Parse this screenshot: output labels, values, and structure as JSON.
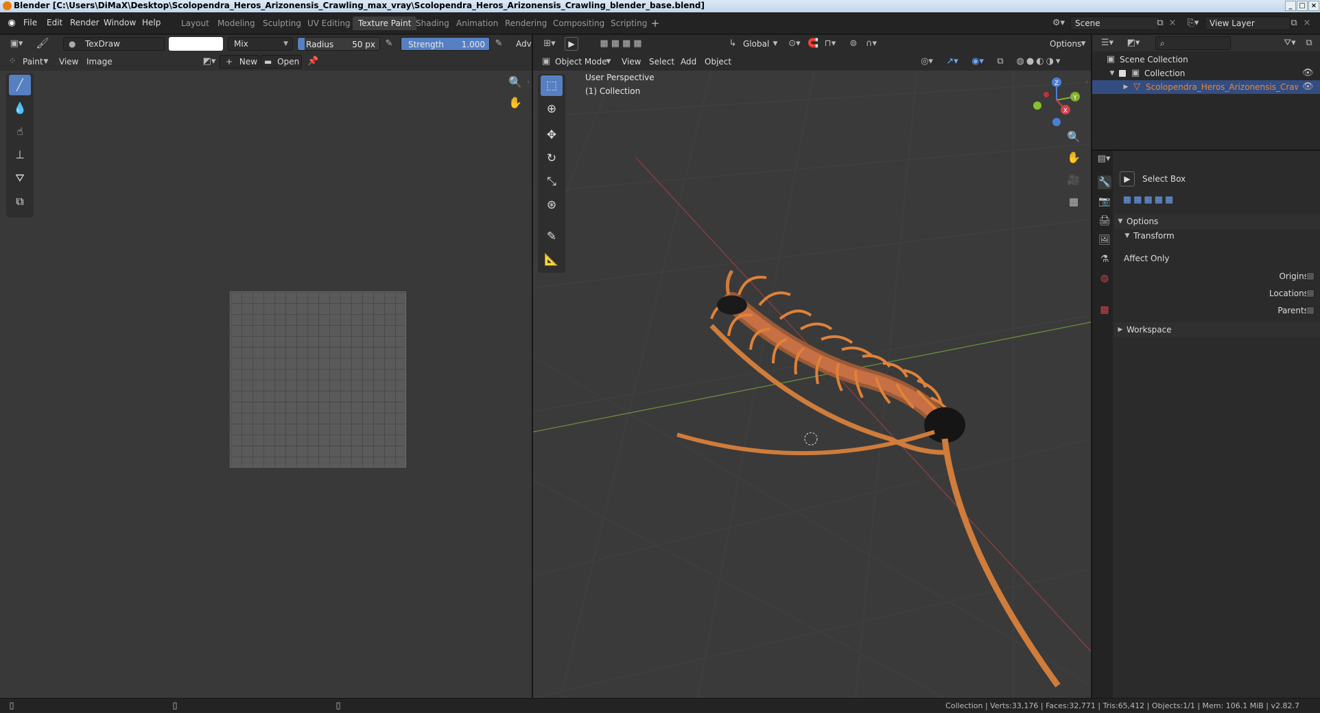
{
  "window": {
    "title": "Blender [C:\\Users\\DiMaX\\Desktop\\Scolopendra_Heros_Arizonensis_Crawling_max_vray\\Scolopendra_Heros_Arizonensis_Crawling_blender_base.blend]"
  },
  "menu": [
    "File",
    "Edit",
    "Render",
    "Window",
    "Help"
  ],
  "workspaces": [
    "Layout",
    "Modeling",
    "Sculpting",
    "UV Editing",
    "Texture Paint",
    "Shading",
    "Animation",
    "Rendering",
    "Compositing",
    "Scripting"
  ],
  "active_workspace": "Texture Paint",
  "scene": {
    "name": "Scene",
    "view_layer": "View Layer"
  },
  "paint_header": {
    "brush": "TexDraw",
    "blend": "Mix",
    "radius_label": "Radius",
    "radius_value": "50 px",
    "strength_label": "Strength",
    "strength_value": "1.000",
    "adv": "Adva"
  },
  "image_editor": {
    "mode": "Paint",
    "menus": [
      "View",
      "Image"
    ],
    "new": "New",
    "open": "Open"
  },
  "viewport": {
    "mode": "Object Mode",
    "menus": [
      "View",
      "Select",
      "Add",
      "Object"
    ],
    "orientation": "Global",
    "options": "Options",
    "overlay_line1": "User Perspective",
    "overlay_line2": "(1) Collection",
    "gizmo_axes": {
      "x": "X",
      "y": "Y",
      "z": "Z"
    }
  },
  "outliner": {
    "root": "Scene Collection",
    "collection": "Collection",
    "object": "Scolopendra_Heros_Arizonensis_Crawling_ol"
  },
  "properties": {
    "tool_name": "Select Box",
    "options": "Options",
    "transform": "Transform",
    "affect_only": "Affect Only",
    "origins": "Origins",
    "locations": "Locations",
    "parents": "Parents",
    "workspace": "Workspace"
  },
  "status": "Collection | Verts:33,176 | Faces:32,771 | Tris:65,412 | Objects:1/1 | Mem: 106.1 MiB | v2.82.7",
  "colors": {
    "accent": "#5680c2",
    "selected_object": "#e8883a",
    "centipede": "#c8662a"
  }
}
